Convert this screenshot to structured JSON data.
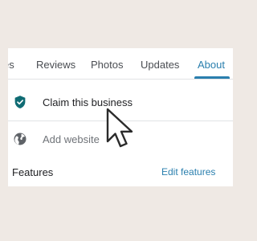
{
  "tabs": [
    {
      "label": "es",
      "active": false
    },
    {
      "label": "Reviews",
      "active": false
    },
    {
      "label": "Photos",
      "active": false
    },
    {
      "label": "Updates",
      "active": false
    },
    {
      "label": "About",
      "active": true
    }
  ],
  "rows": [
    {
      "label": "Claim this business",
      "icon": "verified-shield-icon"
    },
    {
      "label": "Add website",
      "icon": "globe-icon"
    }
  ],
  "features": {
    "title": "Features",
    "edit_label": "Edit features"
  },
  "colors": {
    "accent": "#2a7fae",
    "background": "#efe9e4",
    "verified": "#0f6b73"
  }
}
